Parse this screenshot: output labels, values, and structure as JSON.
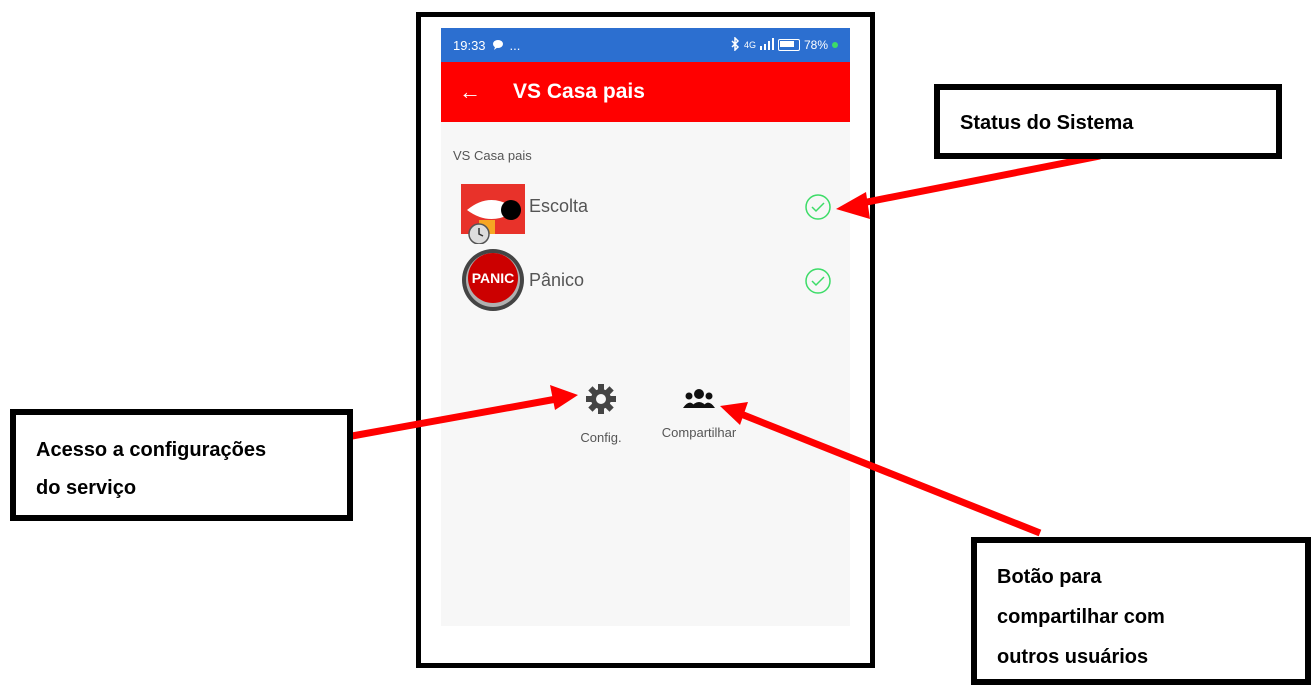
{
  "statusbar": {
    "time": "19:33",
    "indicators": "...",
    "network": "4G",
    "battery": "78%"
  },
  "appbar": {
    "back_icon": "←",
    "title": "VS Casa pais"
  },
  "section": {
    "label": "VS Casa pais"
  },
  "services": [
    {
      "label": "Escolta",
      "status": "ok"
    },
    {
      "label": "Pânico",
      "status": "ok",
      "icon_text": "PANIC"
    }
  ],
  "actions": {
    "config_label": "Config.",
    "share_label": "Compartilhar"
  },
  "annotations": {
    "status": "Status do Sistema",
    "config_line1": "Acesso a configurações",
    "config_line2": "do serviço",
    "share_line1": "Botão para",
    "share_line2": "compartilhar com",
    "share_line3": "outros usuários"
  },
  "colors": {
    "appbar": "#ff0000",
    "statusbar": "#2c6fd0",
    "check": "#3ddc68",
    "arrow": "#ff0000"
  }
}
